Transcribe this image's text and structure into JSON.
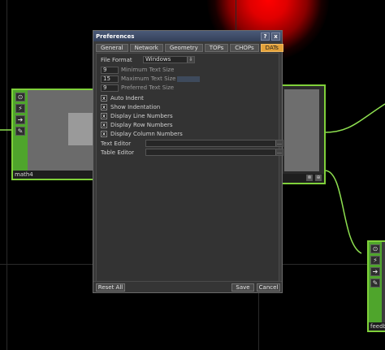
{
  "dialog": {
    "title": "Preferences",
    "help_label": "?",
    "close_label": "x",
    "tabs": [
      {
        "label": "General"
      },
      {
        "label": "Network"
      },
      {
        "label": "Geometry"
      },
      {
        "label": "TOPs"
      },
      {
        "label": "CHOPs"
      },
      {
        "label": "DATs"
      }
    ],
    "active_tab": "DATs",
    "file_format": {
      "label": "File Format",
      "value": "Windows"
    },
    "numeric": [
      {
        "value": "9",
        "label": "Minimum Text Size"
      },
      {
        "value": "15",
        "label": "Maximum Text Size"
      },
      {
        "value": "9",
        "label": "Preferred Text Size"
      }
    ],
    "checkboxes": [
      {
        "label": "Auto Indent",
        "checked": true
      },
      {
        "label": "Show Indentation",
        "checked": true
      },
      {
        "label": "Display Line Numbers",
        "checked": true
      },
      {
        "label": "Display Row Numbers",
        "checked": true
      },
      {
        "label": "Display Column Numbers",
        "checked": true
      }
    ],
    "check_mark": "x",
    "text_editor": {
      "label": "Text Editor",
      "value": ""
    },
    "table_editor": {
      "label": "Table Editor",
      "value": ""
    },
    "buttons": {
      "reset": "Reset All",
      "save": "Save",
      "cancel": "Cancel"
    }
  },
  "network": {
    "nodes": [
      {
        "label": "math4"
      },
      {
        "label": "feedb"
      }
    ]
  },
  "colors": {
    "node_border": "#7fd03a",
    "active_tab": "#e4a23a",
    "wire": "#8ee050",
    "glow": "#ff0000"
  }
}
